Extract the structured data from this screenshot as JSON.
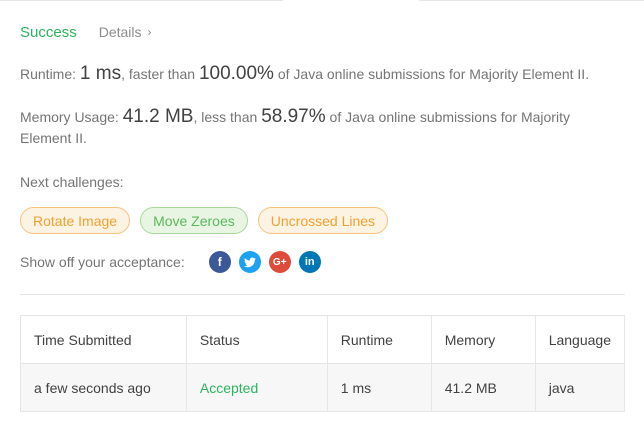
{
  "header": {
    "status": "Success",
    "details_label": "Details"
  },
  "runtime": {
    "label": "Runtime:",
    "value": "1 ms",
    "faster_than_text": ", faster than",
    "percent": "100.00%",
    "suffix": "of Java online submissions for Majority Element II."
  },
  "memory": {
    "label": "Memory Usage:",
    "value": "41.2 MB",
    "less_than_text": ", less than",
    "percent": "58.97%",
    "suffix": "of Java online submissions for Majority Element II."
  },
  "next": {
    "label": "Next challenges:",
    "challenges": [
      {
        "label": "Rotate Image",
        "difficulty": "medium"
      },
      {
        "label": "Move Zeroes",
        "difficulty": "easy"
      },
      {
        "label": "Uncrossed Lines",
        "difficulty": "medium"
      }
    ]
  },
  "share": {
    "label": "Show off your acceptance:",
    "icons": [
      "facebook-icon",
      "twitter-icon",
      "google-plus-icon",
      "linkedin-icon"
    ]
  },
  "table": {
    "headers": [
      "Time Submitted",
      "Status",
      "Runtime",
      "Memory",
      "Language"
    ],
    "rows": [
      [
        "a few seconds ago",
        "Accepted",
        "1 ms",
        "41.2 MB",
        "java"
      ]
    ]
  },
  "colors": {
    "success": "#2db55d",
    "medium": "#f0a030",
    "easy": "#5cb85c"
  }
}
